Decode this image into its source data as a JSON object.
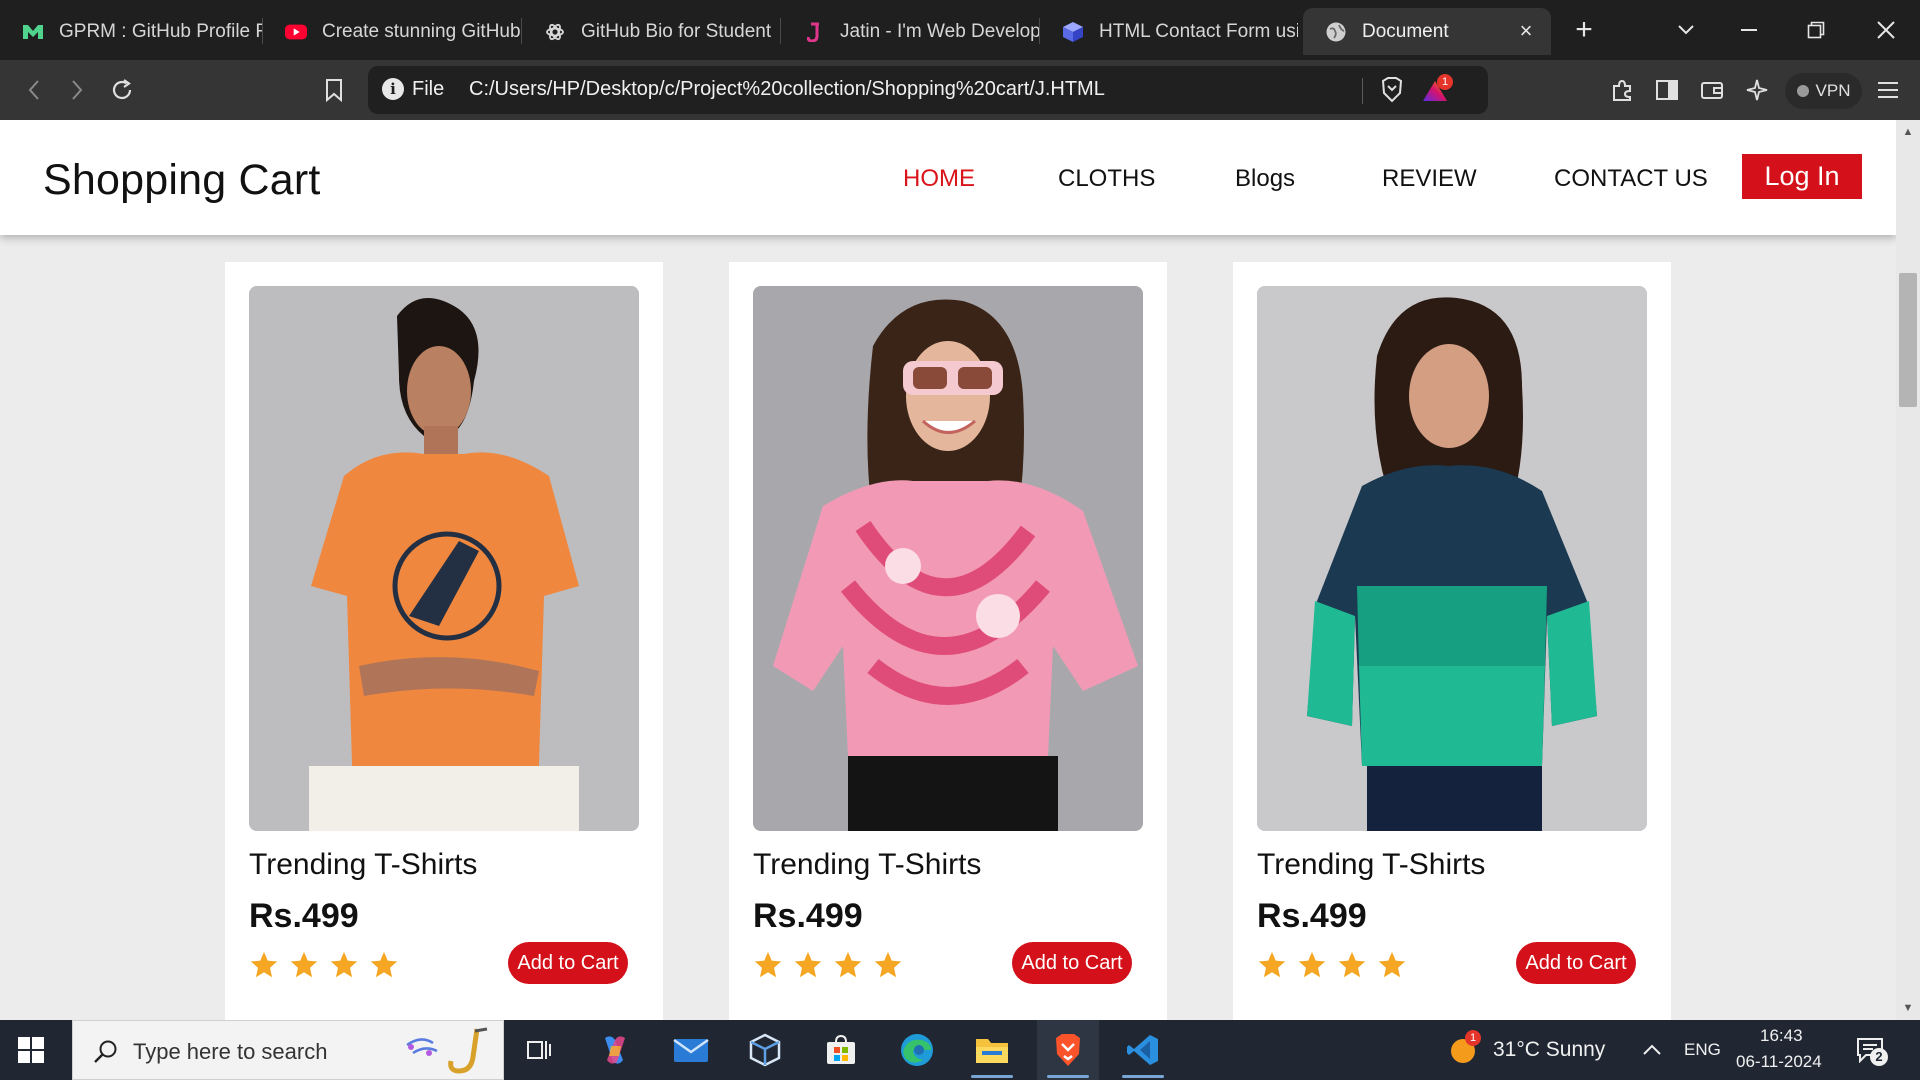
{
  "browser": {
    "tabs": [
      {
        "title": "GPRM : GitHub Profile R",
        "icon": "gprm-logo-icon",
        "active": false
      },
      {
        "title": "Create stunning GitHub",
        "icon": "youtube-icon",
        "active": false
      },
      {
        "title": "GitHub Bio for Student",
        "icon": "openai-icon",
        "active": false
      },
      {
        "title": "Jatin - I'm Web Develop",
        "icon": "letter-j-icon",
        "active": false
      },
      {
        "title": "HTML Contact Form usi",
        "icon": "cube-icon",
        "active": false
      },
      {
        "title": "Document",
        "icon": "globe-icon",
        "active": true
      }
    ],
    "url_scheme": "File",
    "url": "C:/Users/HP/Desktop/c/Project%20collection/Shopping%20cart/J.HTML",
    "rewards_badge": "1",
    "vpn_label": "VPN"
  },
  "site": {
    "brand": "Shopping Cart",
    "nav": [
      {
        "label": "HOME",
        "active": true
      },
      {
        "label": "CLOTHS",
        "active": false
      },
      {
        "label": "Blogs",
        "active": false
      },
      {
        "label": "REVIEW",
        "active": false
      },
      {
        "label": "CONTACT US",
        "active": false
      }
    ],
    "login_label": "Log In",
    "accent_color": "#d4111a",
    "products": [
      {
        "title": "Trending T-Shirts",
        "price": "Rs.499",
        "rating": 4,
        "button": "Add to Cart",
        "image": "woman in orange t-shirt"
      },
      {
        "title": "Trending T-Shirts",
        "price": "Rs.499",
        "rating": 4,
        "button": "Add to Cart",
        "image": "woman in pink tie-dye t-shirt"
      },
      {
        "title": "Trending T-Shirts",
        "price": "Rs.499",
        "rating": 4,
        "button": "Add to Cart",
        "image": "woman in teal and navy long-sleeve top"
      }
    ]
  },
  "taskbar": {
    "search_placeholder": "Type here to search",
    "apps": [
      "task-view-icon",
      "copilot-icon",
      "mail-icon",
      "virtualbox-icon",
      "microsoft-store-icon",
      "edge-icon",
      "file-explorer-icon",
      "brave-icon",
      "vscode-icon"
    ],
    "weather_badge": "1",
    "weather": "31°C  Sunny",
    "language": "ENG",
    "time": "16:43",
    "date": "06-11-2024",
    "notification_count": "2"
  }
}
